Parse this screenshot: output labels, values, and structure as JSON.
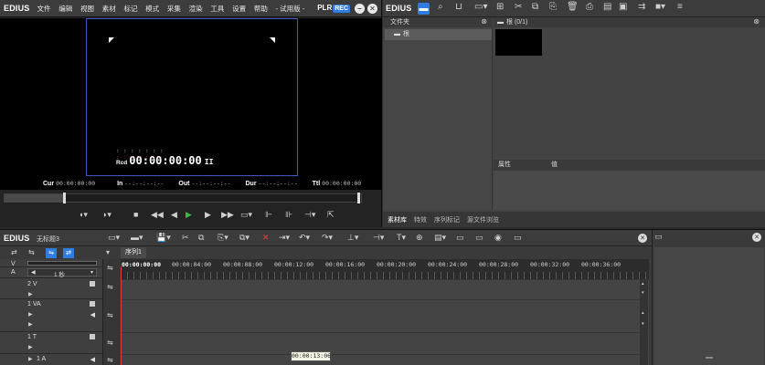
{
  "player": {
    "app_name": "EDIUS",
    "menu": [
      "文件",
      "编辑",
      "视图",
      "素材",
      "标记",
      "模式",
      "采集",
      "渲染",
      "工具",
      "设置",
      "帮助",
      "- 试用版 -"
    ],
    "plr_label": "PLR",
    "rec_label": "REC",
    "timecode_label": "Rcd",
    "timecode": "00:00:00:00",
    "timecode_suffix": "II",
    "cur_label": "Cur",
    "cur_value": "00:00:00:00",
    "in_label": "In",
    "in_value": "--:--:--:--",
    "out_label": "Out",
    "out_value": "--:--:--:--",
    "dur_label": "Dur",
    "dur_value": "--:--:--:--",
    "ttl_label": "Ttl",
    "ttl_value": "00:00:00:00"
  },
  "bin": {
    "folder_header": "文件夹",
    "root_folder": "根",
    "clips_header": "根 (0/1)",
    "prop_header_attr": "属性",
    "prop_header_value": "值",
    "tabs": [
      "素材库",
      "特效",
      "序列标记",
      "源文件浏览"
    ]
  },
  "timeline": {
    "app_name": "EDIUS",
    "project": "无标题3",
    "sequence_tab": "序列1",
    "scale_label": "1 秒",
    "ruler_ticks": [
      "00:00:00:00",
      "00:00:04:00",
      "00:00:08:00",
      "00:00:12:00",
      "00:00:16:00",
      "00:00:20:00",
      "00:00:24:00",
      "00:00:28:00",
      "00:00:32:00",
      "00:00:36:00"
    ],
    "tracks": [
      {
        "label": "V",
        "name": ""
      },
      {
        "label": "A",
        "name": ""
      },
      {
        "label": "",
        "name": "2 V"
      },
      {
        "label": "",
        "name": "1 VA"
      },
      {
        "label": "",
        "name": "1 T"
      },
      {
        "label": "",
        "name": "1 A"
      }
    ],
    "tooltip": "00:00:13:06"
  },
  "colors": {
    "accent": "#2f7de1",
    "playhead": "#e04040",
    "safe_area": "#3e56c6"
  }
}
